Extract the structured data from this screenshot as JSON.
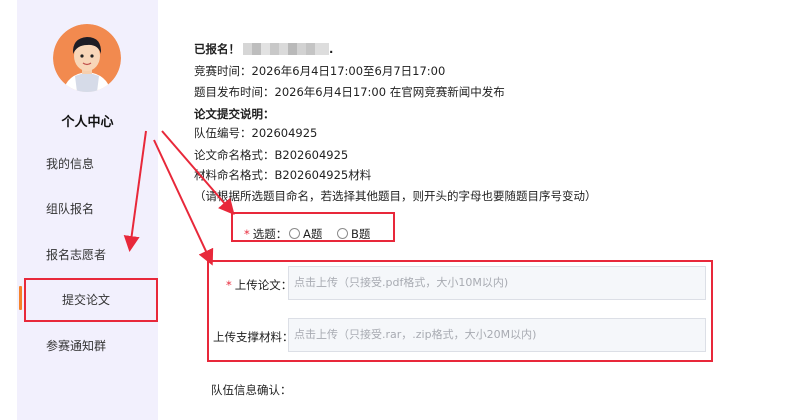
{
  "sidebar": {
    "title": "个人中心",
    "items": [
      {
        "label": "我的信息"
      },
      {
        "label": "组队报名"
      },
      {
        "label": "报名志愿者"
      },
      {
        "label": "提交论文",
        "active": true
      },
      {
        "label": "参赛通知群"
      }
    ]
  },
  "info": {
    "registered": "已报名！",
    "registered_suffix": ".",
    "contest_time": "竞赛时间：2026年6月4日17:00至6月7日17:00",
    "release_time": "题目发布时间：2026年6月4日17:00 在官网竞赛新闻中发布",
    "submit_title": "论文提交说明：",
    "team_no": "队伍编号：202604925",
    "paper_format": "论文命名格式：B202604925",
    "material_format": "材料命名格式：B202604925材料",
    "note": "（请根据所选题目命名，若选择其他题目，则开头的字母也要随题目序号变动）"
  },
  "form": {
    "topic_label": "选题：",
    "topic_required": "*",
    "topic_options": [
      "A题",
      "B题"
    ],
    "paper_label": "上传论文：",
    "paper_required": "*",
    "paper_placeholder": "点击上传（只接受.pdf格式，大小10M以内)",
    "material_label": "上传支撑材料：",
    "material_placeholder": "点击上传（只接受.rar，.zip格式，大小20M以内)",
    "team_confirm_label": "队伍信息确认："
  },
  "colors": {
    "accent": "#f5822a",
    "annotation_red": "#e8283a",
    "sidebar_bg": "#f2f0fd"
  }
}
